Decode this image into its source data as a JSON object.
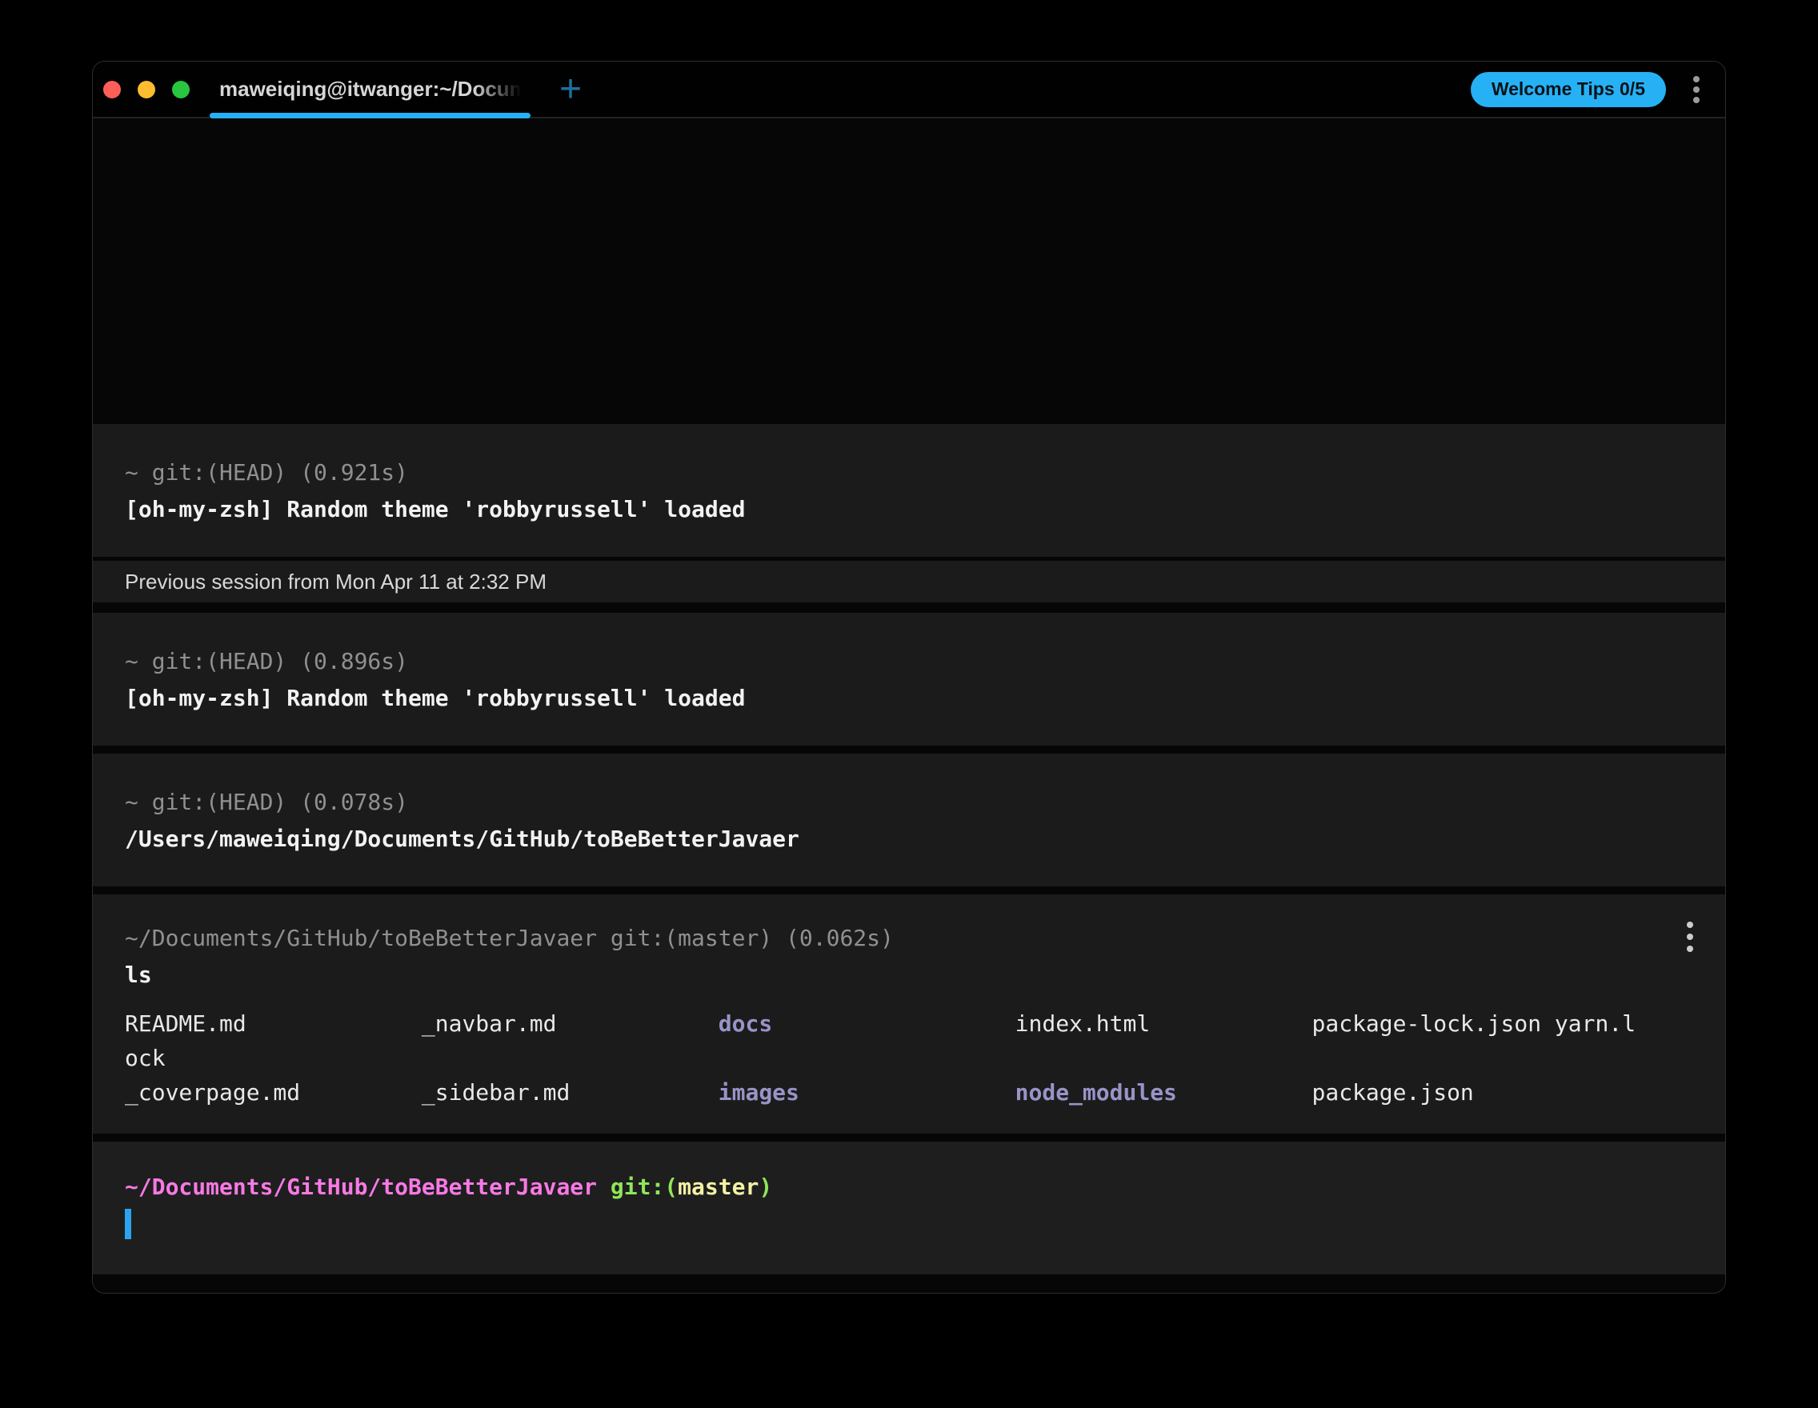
{
  "titlebar": {
    "tab_title": "maweiqing@itwanger:~/Docum",
    "new_tab_label": "+",
    "welcome_tips_label": "Welcome Tips 0/5"
  },
  "colors": {
    "accent_blue": "#27b1f5",
    "cursor_blue": "#2da3f0",
    "plus_blue": "#1e6f9e",
    "traffic_red": "#ff5f57",
    "traffic_yellow": "#febc2e",
    "traffic_green": "#29c63f",
    "dir_lavender": "#9894c8"
  },
  "blocks": [
    {
      "kind": "command",
      "header": "~ git:(HEAD) (0.921s)",
      "output": "[oh-my-zsh] Random theme 'robbyrussell' loaded"
    },
    {
      "kind": "session-divider",
      "label": "Previous session from Mon Apr 11 at 2:32 PM"
    },
    {
      "kind": "command",
      "header": "~ git:(HEAD) (0.896s)",
      "output": "[oh-my-zsh] Random theme 'robbyrussell' loaded"
    },
    {
      "kind": "command",
      "header": "~ git:(HEAD) (0.078s)",
      "output": "/Users/maweiqing/Documents/GitHub/toBeBetterJavaer"
    },
    {
      "kind": "command-ls",
      "header": "~/Documents/GitHub/toBeBetterJavaer git:(master) (0.062s)",
      "command": "ls",
      "ls_rows": [
        [
          {
            "text": "README.md             ",
            "type": "file"
          },
          {
            "text": "_navbar.md            ",
            "type": "file"
          },
          {
            "text": "docs                  ",
            "type": "dir"
          },
          {
            "text": "index.html            ",
            "type": "file"
          },
          {
            "text": "package-lock.json yarn.l",
            "type": "file"
          }
        ],
        [
          {
            "text": "ock",
            "type": "file"
          }
        ],
        [
          {
            "text": "_coverpage.md         ",
            "type": "file"
          },
          {
            "text": "_sidebar.md           ",
            "type": "file"
          },
          {
            "text": "images                ",
            "type": "dir"
          },
          {
            "text": "node_modules          ",
            "type": "dir"
          },
          {
            "text": "package.json",
            "type": "file"
          }
        ]
      ]
    },
    {
      "kind": "prompt",
      "segments": [
        {
          "text": "~/Documents/GitHub/toBeBetterJavaer",
          "color": "#f779e4"
        },
        {
          "text": " git:(",
          "color": "#8fe659"
        },
        {
          "text": "master",
          "color": "#f3f1a4"
        },
        {
          "text": ")",
          "color": "#8fe659"
        }
      ]
    }
  ]
}
